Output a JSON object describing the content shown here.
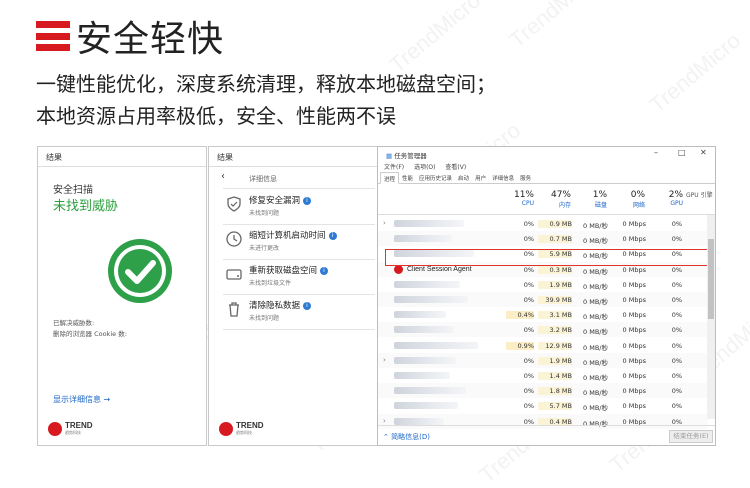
{
  "header": {
    "title": "安全轻快",
    "line1": "一键性能优化，深度系统清理，释放本地磁盘空间；",
    "line2": "本地资源占用率极低，安全、性能两不误",
    "accent": "#d71920"
  },
  "watermark": "TrendMicro",
  "scan_window": {
    "title": "结果",
    "scan_label": "安全扫描",
    "scan_result": "未找到威胁",
    "note1": "已解决威胁数:",
    "note2": "删除的浏览器 Cookie 数:",
    "detail_link": "显示详细信息",
    "logo_text": "TREND",
    "logo_sub": "趋势科技",
    "status_color": "#2ea04a"
  },
  "detail_window": {
    "title": "结果",
    "crumb": "详细信息",
    "tasks": [
      {
        "title": "修复安全漏洞",
        "sub": "未找到问题",
        "icon": "shield-tool-icon"
      },
      {
        "title": "缩短计算机启动时间",
        "sub": "未进行更改",
        "icon": "clock-icon"
      },
      {
        "title": "重新获取磁盘空间",
        "sub": "未找到垃圾文件",
        "icon": "disk-icon"
      },
      {
        "title": "清除隐私数据",
        "sub": "未找到问题",
        "icon": "trash-icon"
      }
    ],
    "logo_text": "TREND",
    "logo_sub": "趋势科技"
  },
  "task_manager": {
    "title": "任务管理器",
    "menu": [
      "文件(F)",
      "选项(O)",
      "查看(V)"
    ],
    "tabs": [
      "进程",
      "性能",
      "应用历史记录",
      "启动",
      "用户",
      "详细信息",
      "服务"
    ],
    "columns": [
      {
        "pct": "11%",
        "label": "CPU"
      },
      {
        "pct": "47%",
        "label": "内存"
      },
      {
        "pct": "1%",
        "label": "磁盘"
      },
      {
        "pct": "0%",
        "label": "网络"
      },
      {
        "pct": "2%",
        "label": "GPU"
      },
      {
        "pct": "",
        "label": "GPU 引擎"
      }
    ],
    "rows": [
      {
        "arrow": "›",
        "cpu": "0%",
        "mem": "0.9 MB",
        "disk": "0 MB/秒",
        "net": "0 Mbps",
        "gpu": "0%"
      },
      {
        "arrow": "",
        "cpu": "0%",
        "mem": "0.7 MB",
        "disk": "0 MB/秒",
        "net": "0 Mbps",
        "gpu": "0%"
      },
      {
        "arrow": "",
        "cpu": "0%",
        "mem": "5.9 MB",
        "disk": "0 MB/秒",
        "net": "0 Mbps",
        "gpu": "0%"
      },
      {
        "arrow": "",
        "name": "Client Session Agent",
        "cpu": "0%",
        "mem": "0.3 MB",
        "disk": "0 MB/秒",
        "net": "0 Mbps",
        "gpu": "0%",
        "highlight": true
      },
      {
        "arrow": "",
        "cpu": "0%",
        "mem": "1.9 MB",
        "disk": "0 MB/秒",
        "net": "0 Mbps",
        "gpu": "0%"
      },
      {
        "arrow": "",
        "cpu": "0%",
        "mem": "39.9 MB",
        "disk": "0 MB/秒",
        "net": "0 Mbps",
        "gpu": "0%"
      },
      {
        "arrow": "",
        "cpu": "0.4%",
        "mem": "3.1 MB",
        "disk": "0 MB/秒",
        "net": "0 Mbps",
        "gpu": "0%"
      },
      {
        "arrow": "",
        "cpu": "0%",
        "mem": "3.2 MB",
        "disk": "0 MB/秒",
        "net": "0 Mbps",
        "gpu": "0%"
      },
      {
        "arrow": "",
        "cpu": "0.9%",
        "mem": "12.9 MB",
        "disk": "0 MB/秒",
        "net": "0 Mbps",
        "gpu": "0%"
      },
      {
        "arrow": "›",
        "cpu": "0%",
        "mem": "1.9 MB",
        "disk": "0 MB/秒",
        "net": "0 Mbps",
        "gpu": "0%"
      },
      {
        "arrow": "",
        "cpu": "0%",
        "mem": "1.4 MB",
        "disk": "0 MB/秒",
        "net": "0 Mbps",
        "gpu": "0%"
      },
      {
        "arrow": "",
        "cpu": "0%",
        "mem": "1.8 MB",
        "disk": "0 MB/秒",
        "net": "0 Mbps",
        "gpu": "0%"
      },
      {
        "arrow": "",
        "cpu": "0%",
        "mem": "5.7 MB",
        "disk": "0 MB/秒",
        "net": "0 Mbps",
        "gpu": "0%"
      },
      {
        "arrow": "›",
        "cpu": "0%",
        "mem": "0.4 MB",
        "disk": "0 MB/秒",
        "net": "0 Mbps",
        "gpu": "0%"
      }
    ],
    "fewer_details": "简略信息(D)",
    "end_task": "结束任务(E)",
    "highlight_color": "#e0332c"
  }
}
